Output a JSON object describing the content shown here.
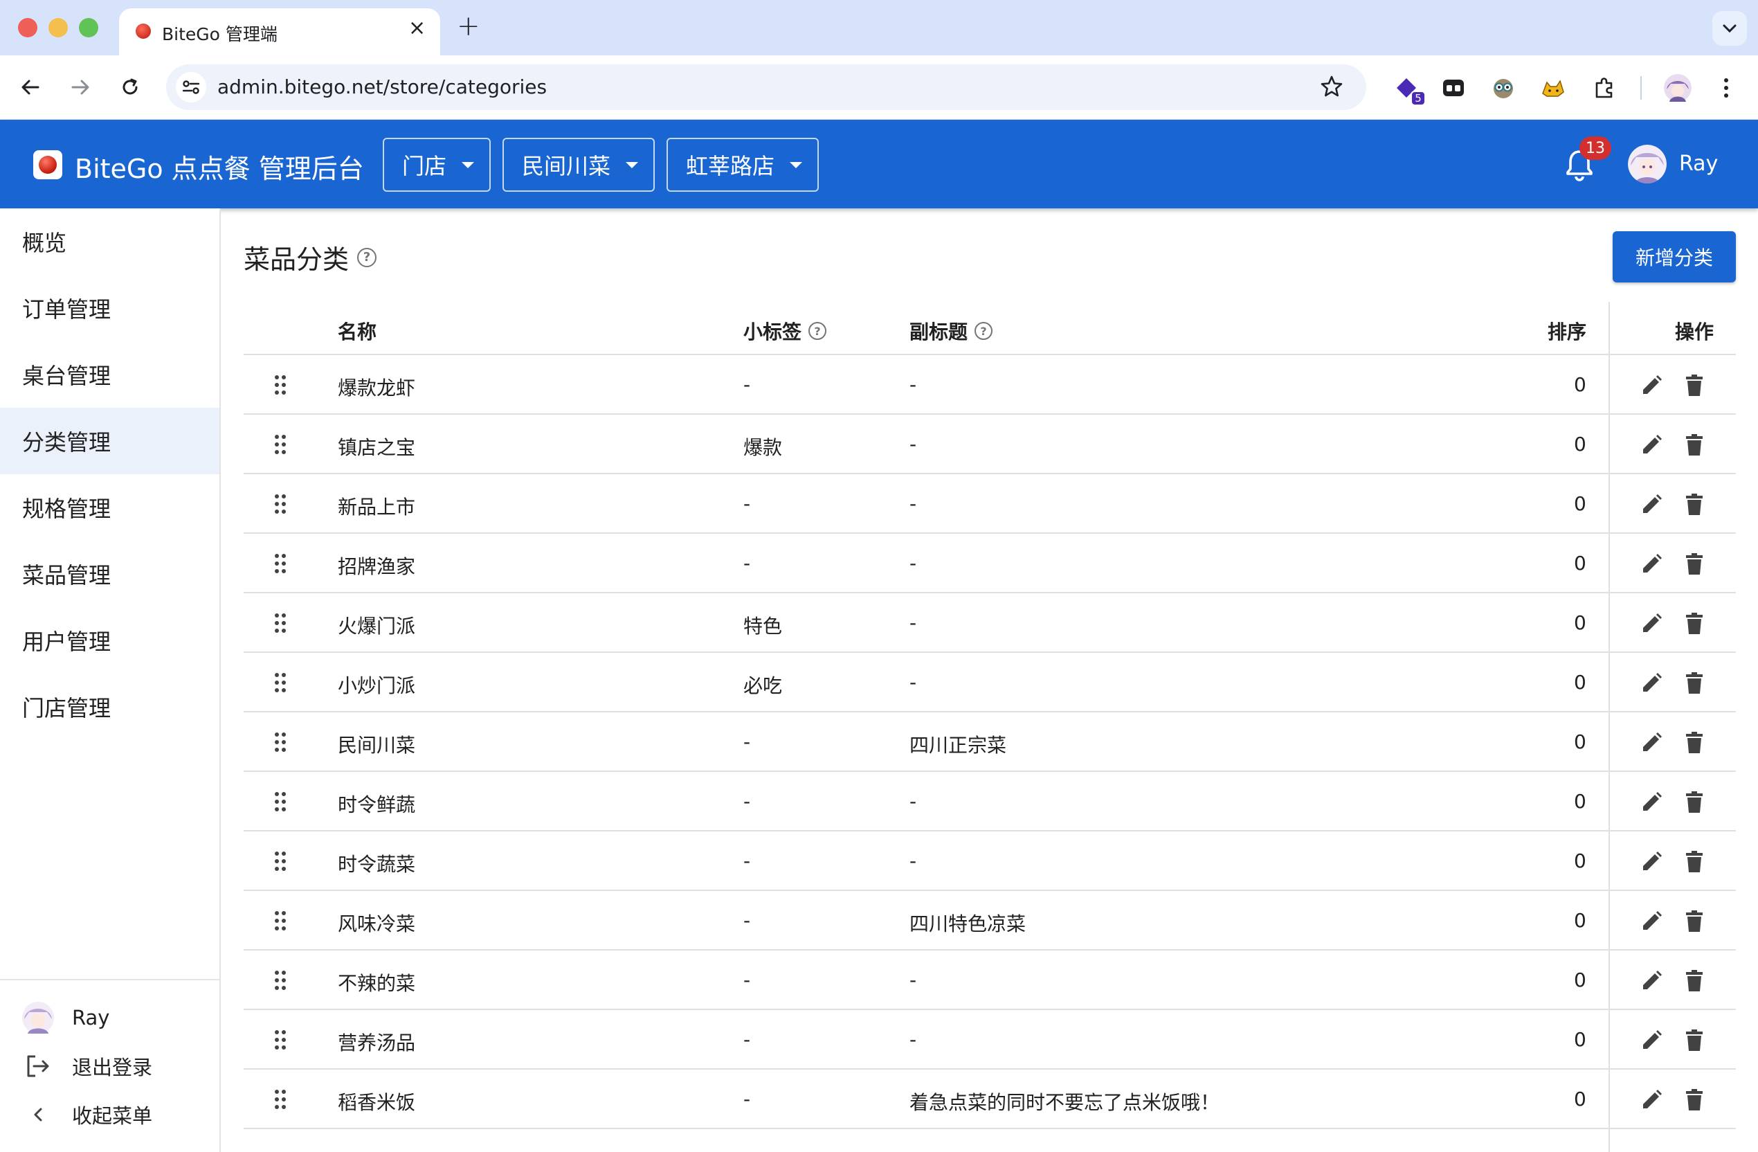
{
  "browser": {
    "tab_title": "BiteGo 管理端",
    "url": "admin.bitego.net/store/categories",
    "extension_badge": "5"
  },
  "header": {
    "title": "BiteGo 点点餐 管理后台",
    "selects": [
      "门店",
      "民间川菜",
      "虹莘路店"
    ],
    "notification_count": "13",
    "user_name": "Ray"
  },
  "sidebar": {
    "items": [
      {
        "label": "概览"
      },
      {
        "label": "订单管理"
      },
      {
        "label": "桌台管理"
      },
      {
        "label": "分类管理"
      },
      {
        "label": "规格管理"
      },
      {
        "label": "菜品管理"
      },
      {
        "label": "用户管理"
      },
      {
        "label": "门店管理"
      }
    ],
    "active_item": "分类管理",
    "footer": {
      "user_name": "Ray",
      "logout_label": "退出登录",
      "collapse_label": "收起菜单"
    }
  },
  "main": {
    "title": "菜品分类",
    "add_button": "新增分类",
    "columns": {
      "name": "名称",
      "tag": "小标签",
      "subtitle": "副标题",
      "sort": "排序",
      "actions": "操作"
    },
    "rows": [
      {
        "name": "爆款龙虾",
        "tag": "-",
        "subtitle": "-",
        "sort": "0"
      },
      {
        "name": "镇店之宝",
        "tag": "爆款",
        "subtitle": "-",
        "sort": "0"
      },
      {
        "name": "新品上市",
        "tag": "-",
        "subtitle": "-",
        "sort": "0"
      },
      {
        "name": "招牌渔家",
        "tag": "-",
        "subtitle": "-",
        "sort": "0"
      },
      {
        "name": "火爆门派",
        "tag": "特色",
        "subtitle": "-",
        "sort": "0"
      },
      {
        "name": "小炒门派",
        "tag": "必吃",
        "subtitle": "-",
        "sort": "0"
      },
      {
        "name": "民间川菜",
        "tag": "-",
        "subtitle": "四川正宗菜",
        "sort": "0"
      },
      {
        "name": "时令鲜蔬",
        "tag": "-",
        "subtitle": "-",
        "sort": "0"
      },
      {
        "name": "时令蔬菜",
        "tag": "-",
        "subtitle": "-",
        "sort": "0"
      },
      {
        "name": "风味冷菜",
        "tag": "-",
        "subtitle": "四川特色凉菜",
        "sort": "0"
      },
      {
        "name": "不辣的菜",
        "tag": "-",
        "subtitle": "-",
        "sort": "0"
      },
      {
        "name": "营养汤品",
        "tag": "-",
        "subtitle": "-",
        "sort": "0"
      },
      {
        "name": "稻香米饭",
        "tag": "-",
        "subtitle": "着急点菜的同时不要忘了点米饭哦！",
        "sort": "0"
      }
    ]
  },
  "colors": {
    "primary": "#1966d2",
    "active_nav_bg": "#eaf1fb",
    "badge_red": "#d32f2f"
  }
}
